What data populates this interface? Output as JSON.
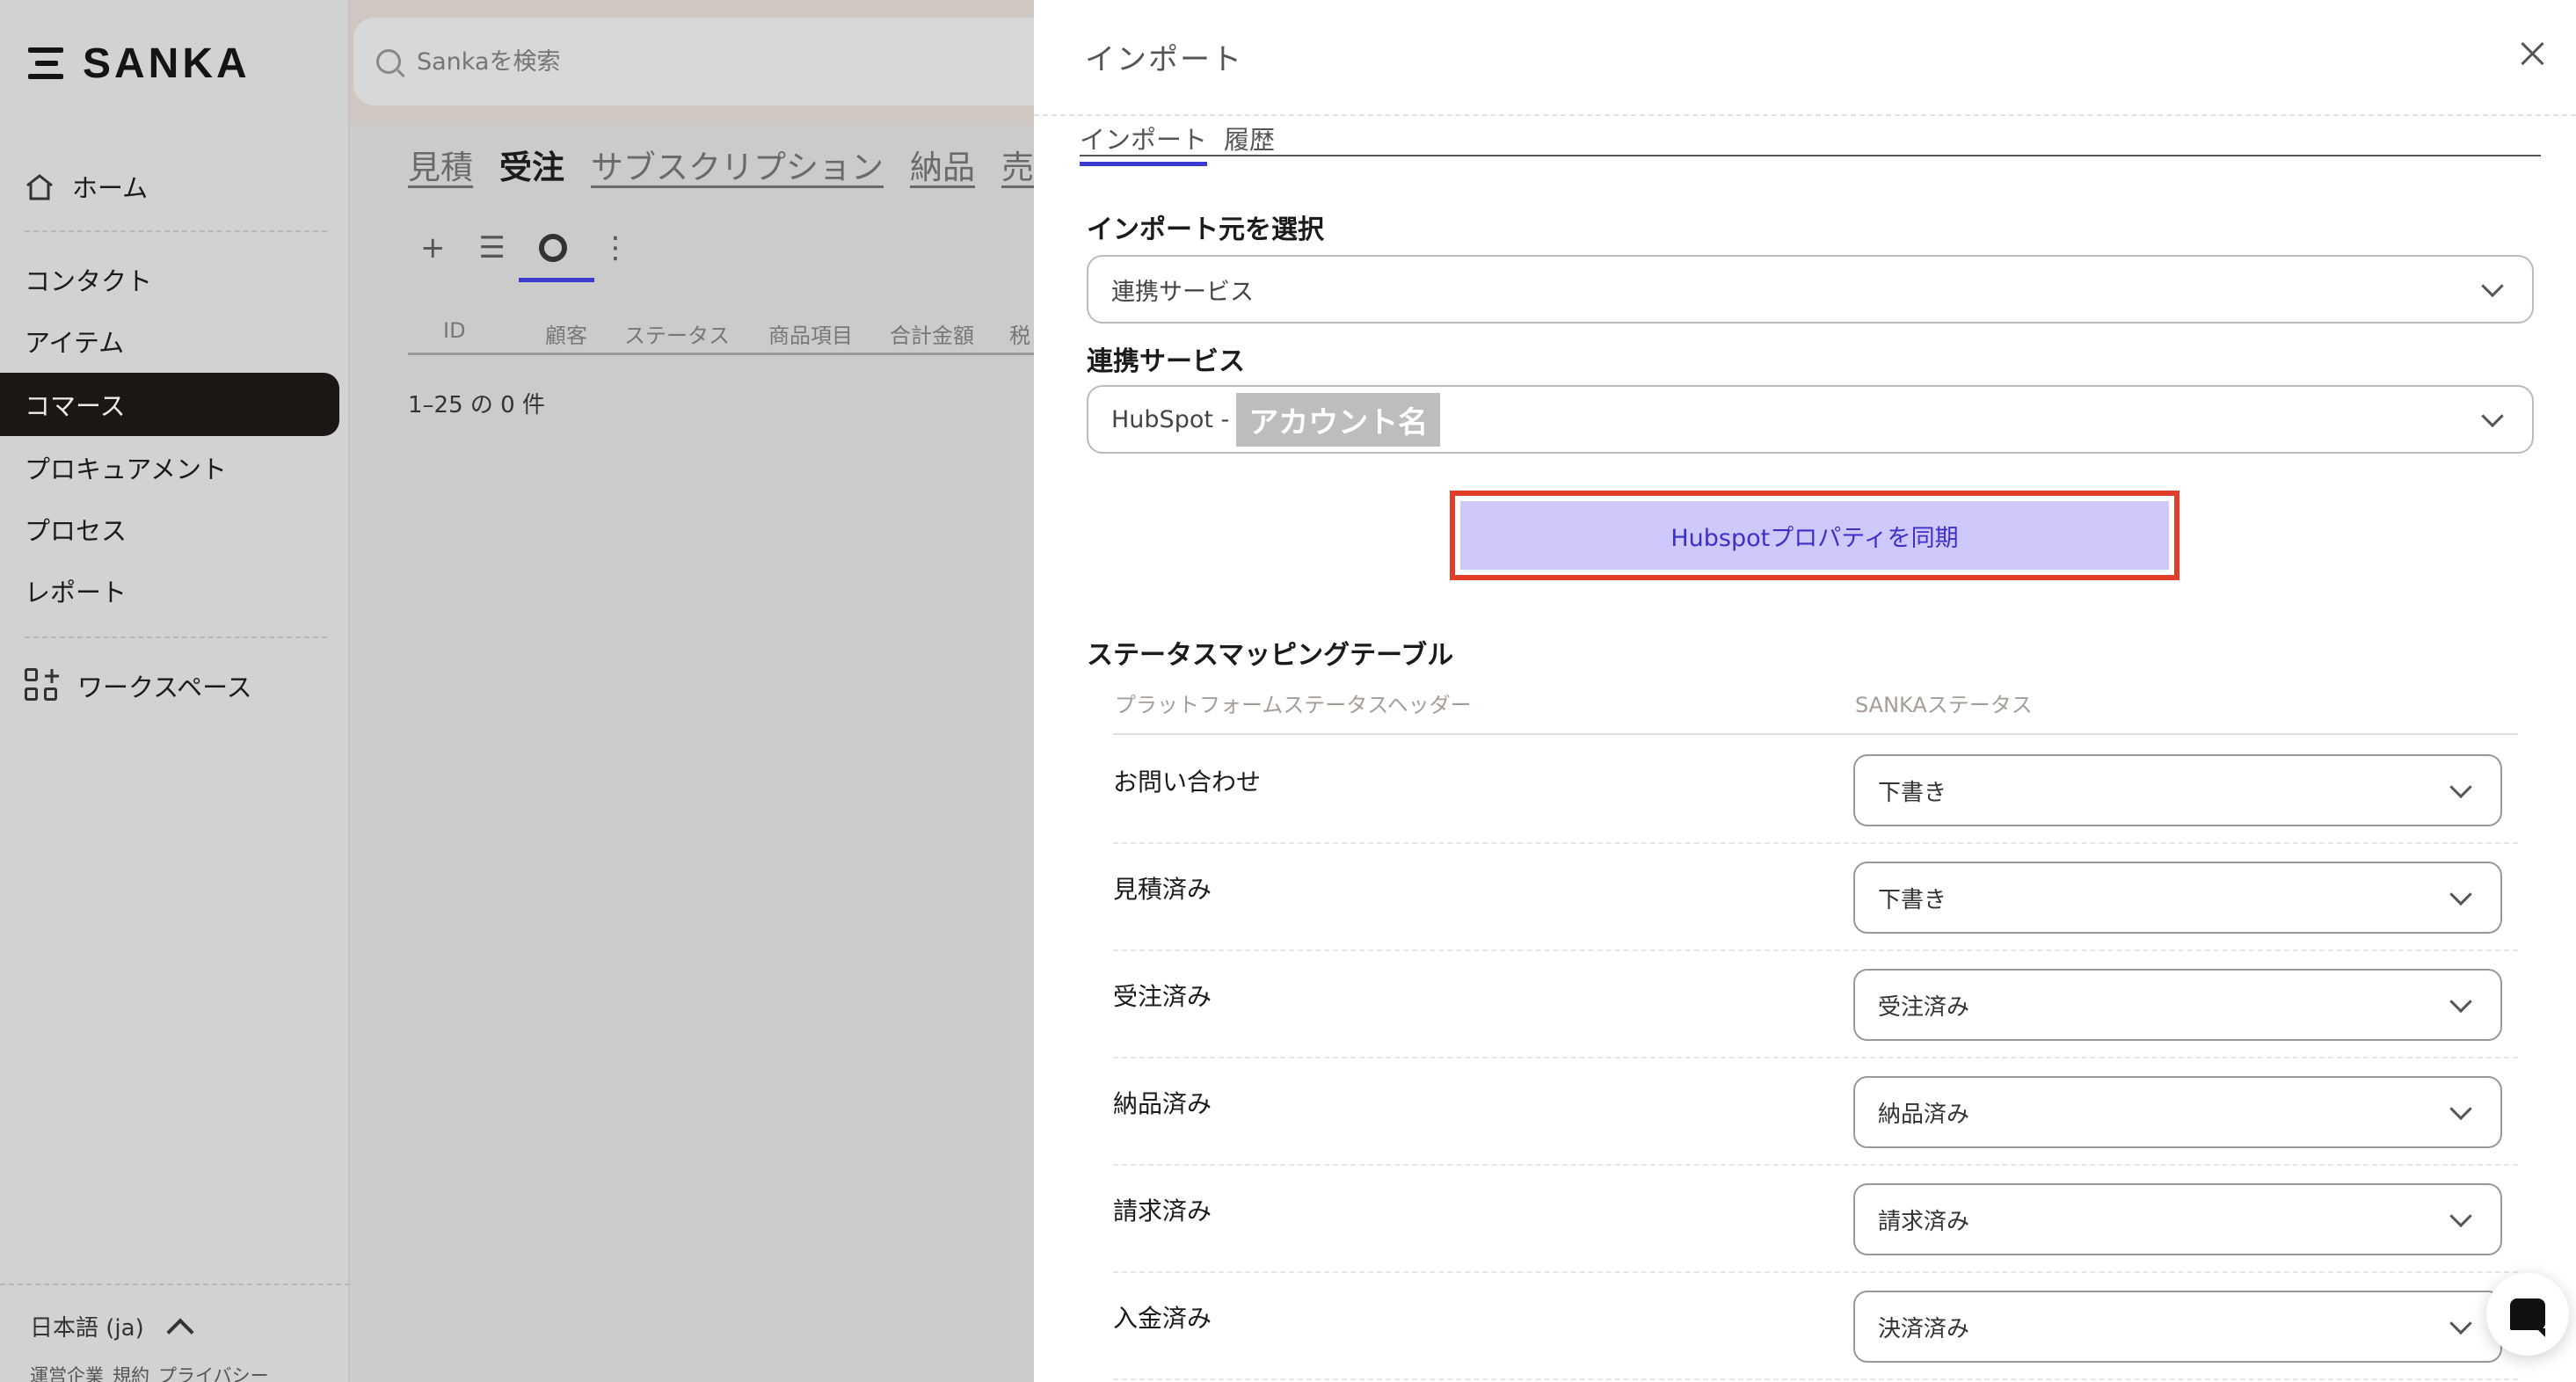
{
  "app": {
    "logo": "SANKA",
    "search_placeholder": "Sankaを検索"
  },
  "sidebar": {
    "items": [
      {
        "label": "ホーム"
      },
      {
        "label": "コンタクト"
      },
      {
        "label": "アイテム"
      },
      {
        "label": "コマース"
      },
      {
        "label": "プロキュアメント"
      },
      {
        "label": "プロセス"
      },
      {
        "label": "レポート"
      },
      {
        "label": "ワークスペース"
      }
    ],
    "language": "日本語 (ja)",
    "links": [
      "運営企業",
      "規約",
      "プライバシー"
    ]
  },
  "main": {
    "tabs": [
      "見積",
      "受注",
      "サブスクリプション",
      "納品",
      "売上"
    ],
    "toolbar": {
      "add": "+",
      "list": "☰",
      "more": "⋮"
    },
    "columns": [
      "ID",
      "顧客",
      "ステータス",
      "商品項目",
      "合計金額",
      "税"
    ],
    "count": "1–25 の 0 件"
  },
  "panel": {
    "title": "インポート",
    "tabs": [
      "インポート",
      "履歴"
    ],
    "source_label": "インポート元を選択",
    "source_value": "連携サービス",
    "service_label": "連携サービス",
    "service_prefix": "HubSpot -",
    "service_account": "アカウント名",
    "sync_button": "Hubspotプロパティを同期",
    "mapping_title": "ステータスマッピングテーブル",
    "mapping_head_platform": "プラットフォームステータスヘッダー",
    "mapping_head_sanka": "SANKAステータス",
    "mapping_rows": [
      {
        "platform": "お問い合わせ",
        "sanka": "下書き"
      },
      {
        "platform": "見積済み",
        "sanka": "下書き"
      },
      {
        "platform": "受注済み",
        "sanka": "受注済み"
      },
      {
        "platform": "納品済み",
        "sanka": "納品済み"
      },
      {
        "platform": "請求済み",
        "sanka": "請求済み"
      },
      {
        "platform": "入金済み",
        "sanka": "決済済み"
      }
    ]
  },
  "colors": {
    "accent": "#3b3bd0",
    "sync_button_bg": "#cfc8fa",
    "highlight_frame": "#e23c2a",
    "active_nav_bg": "#1c1614"
  },
  "icons": [
    "menu-icon",
    "search-icon",
    "home-icon",
    "workspace-icon",
    "close-icon",
    "chevron-down-icon",
    "chat-icon"
  ]
}
